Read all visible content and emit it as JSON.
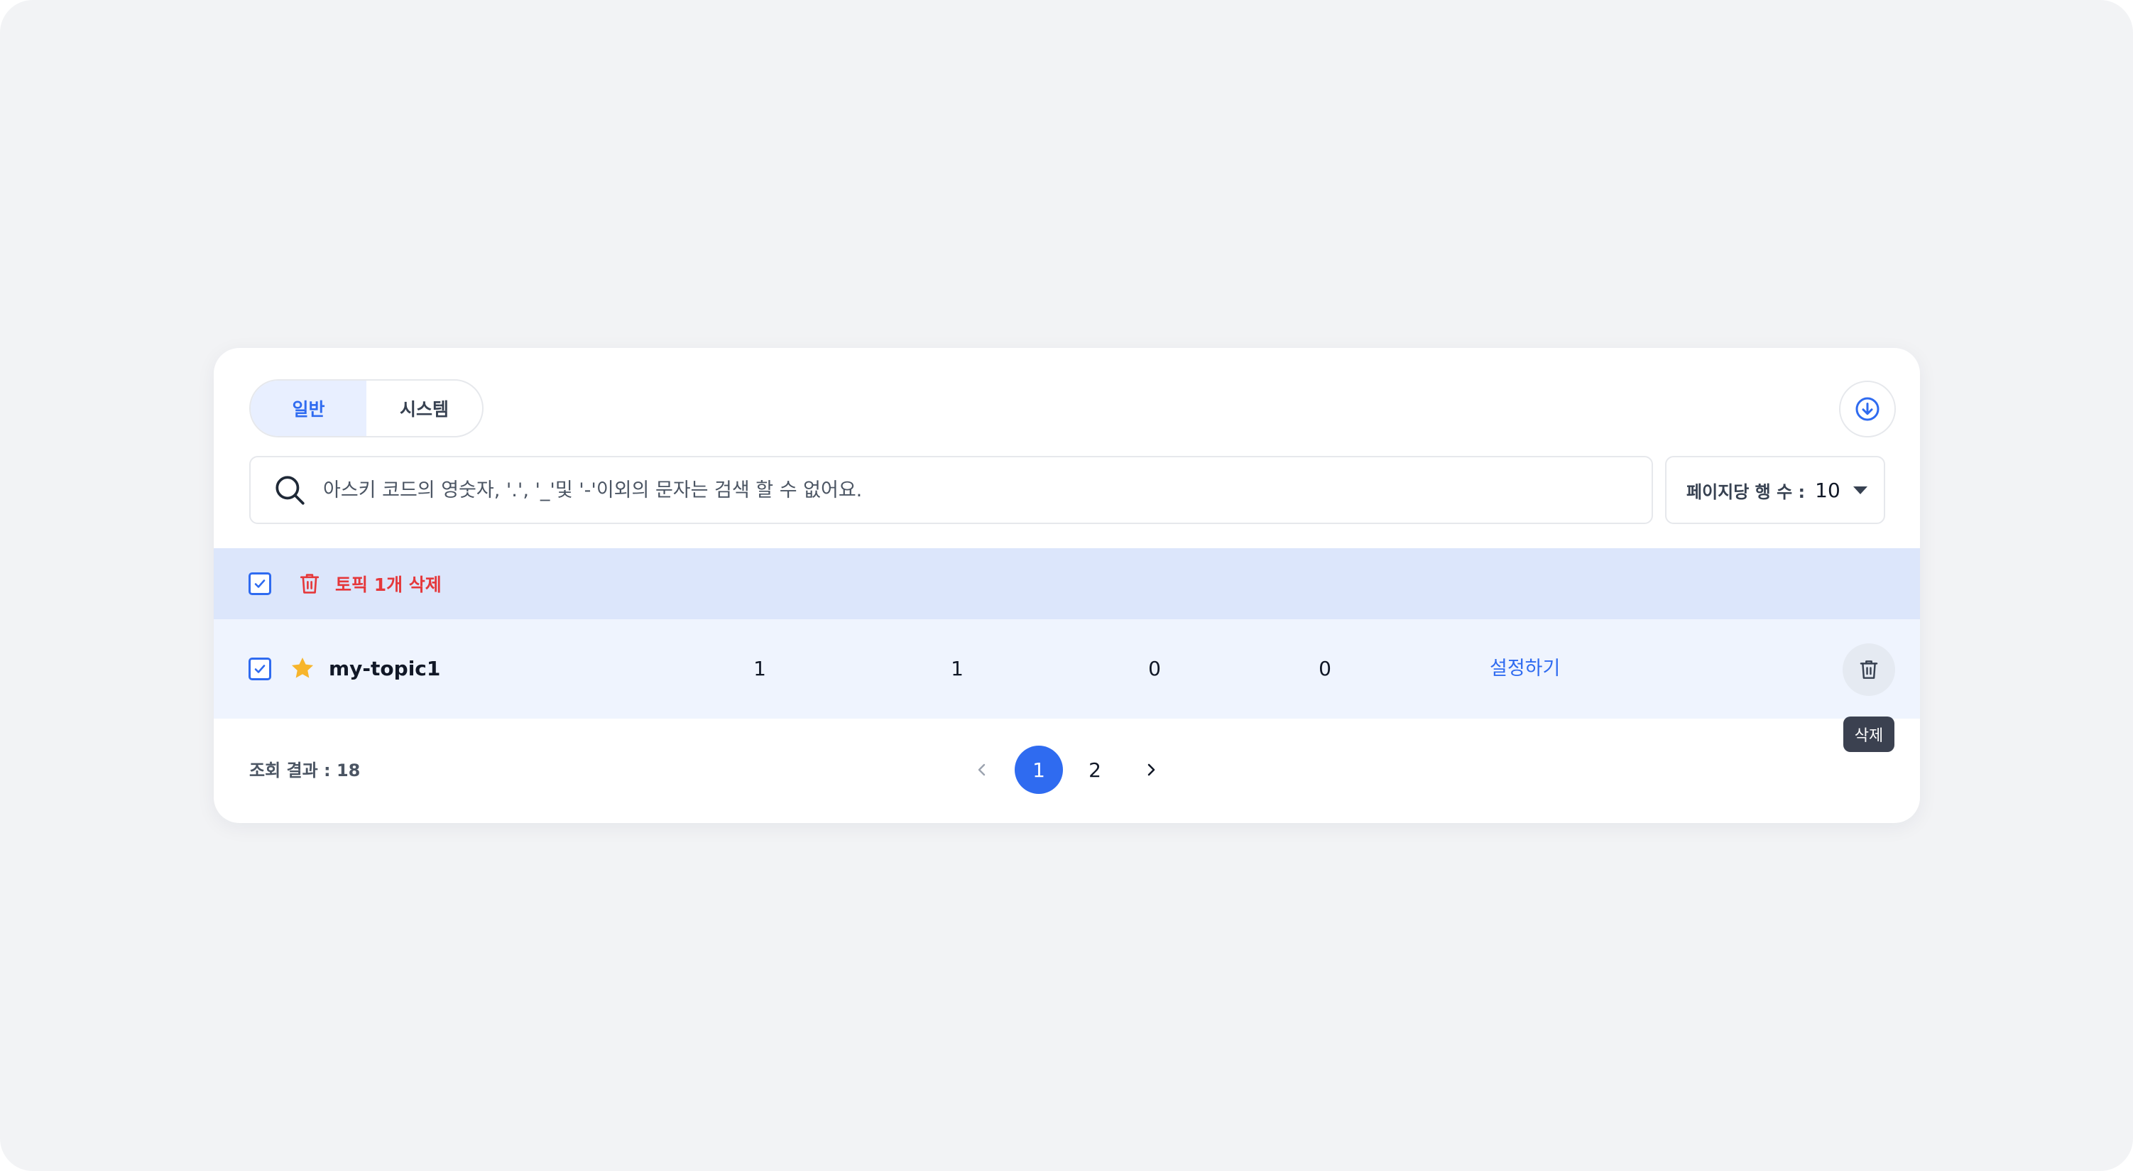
{
  "tabs": [
    {
      "label": "일반",
      "active": true
    },
    {
      "label": "시스템",
      "active": false
    }
  ],
  "download_icon": "download-circle-icon",
  "search": {
    "placeholder": "아스키 코드의 영숫자, '.', '_'및 '-'이외의 문자는 검색 할 수 없어요.",
    "value": ""
  },
  "rows_per_page": {
    "label": "페이지당 행 수 :",
    "value": "10"
  },
  "selection_bar": {
    "delete_label": "토픽 1개 삭제"
  },
  "table": {
    "rows": [
      {
        "checked": true,
        "favorite": true,
        "name": "my-topic1",
        "col1": "1",
        "col2": "1",
        "col3": "0",
        "col4": "0",
        "action": "설정하기"
      }
    ]
  },
  "tooltip": {
    "delete": "삭제"
  },
  "footer": {
    "result": "조회 결과 : 18",
    "pages": [
      "1",
      "2"
    ],
    "current_page": "1"
  },
  "colors": {
    "accent": "#2f6bf0",
    "danger": "#e5383b",
    "star": "#f7b52c",
    "selection_bg": "#dce6fb",
    "row_bg": "#eff4fe",
    "page_bg": "#f2f3f5"
  }
}
